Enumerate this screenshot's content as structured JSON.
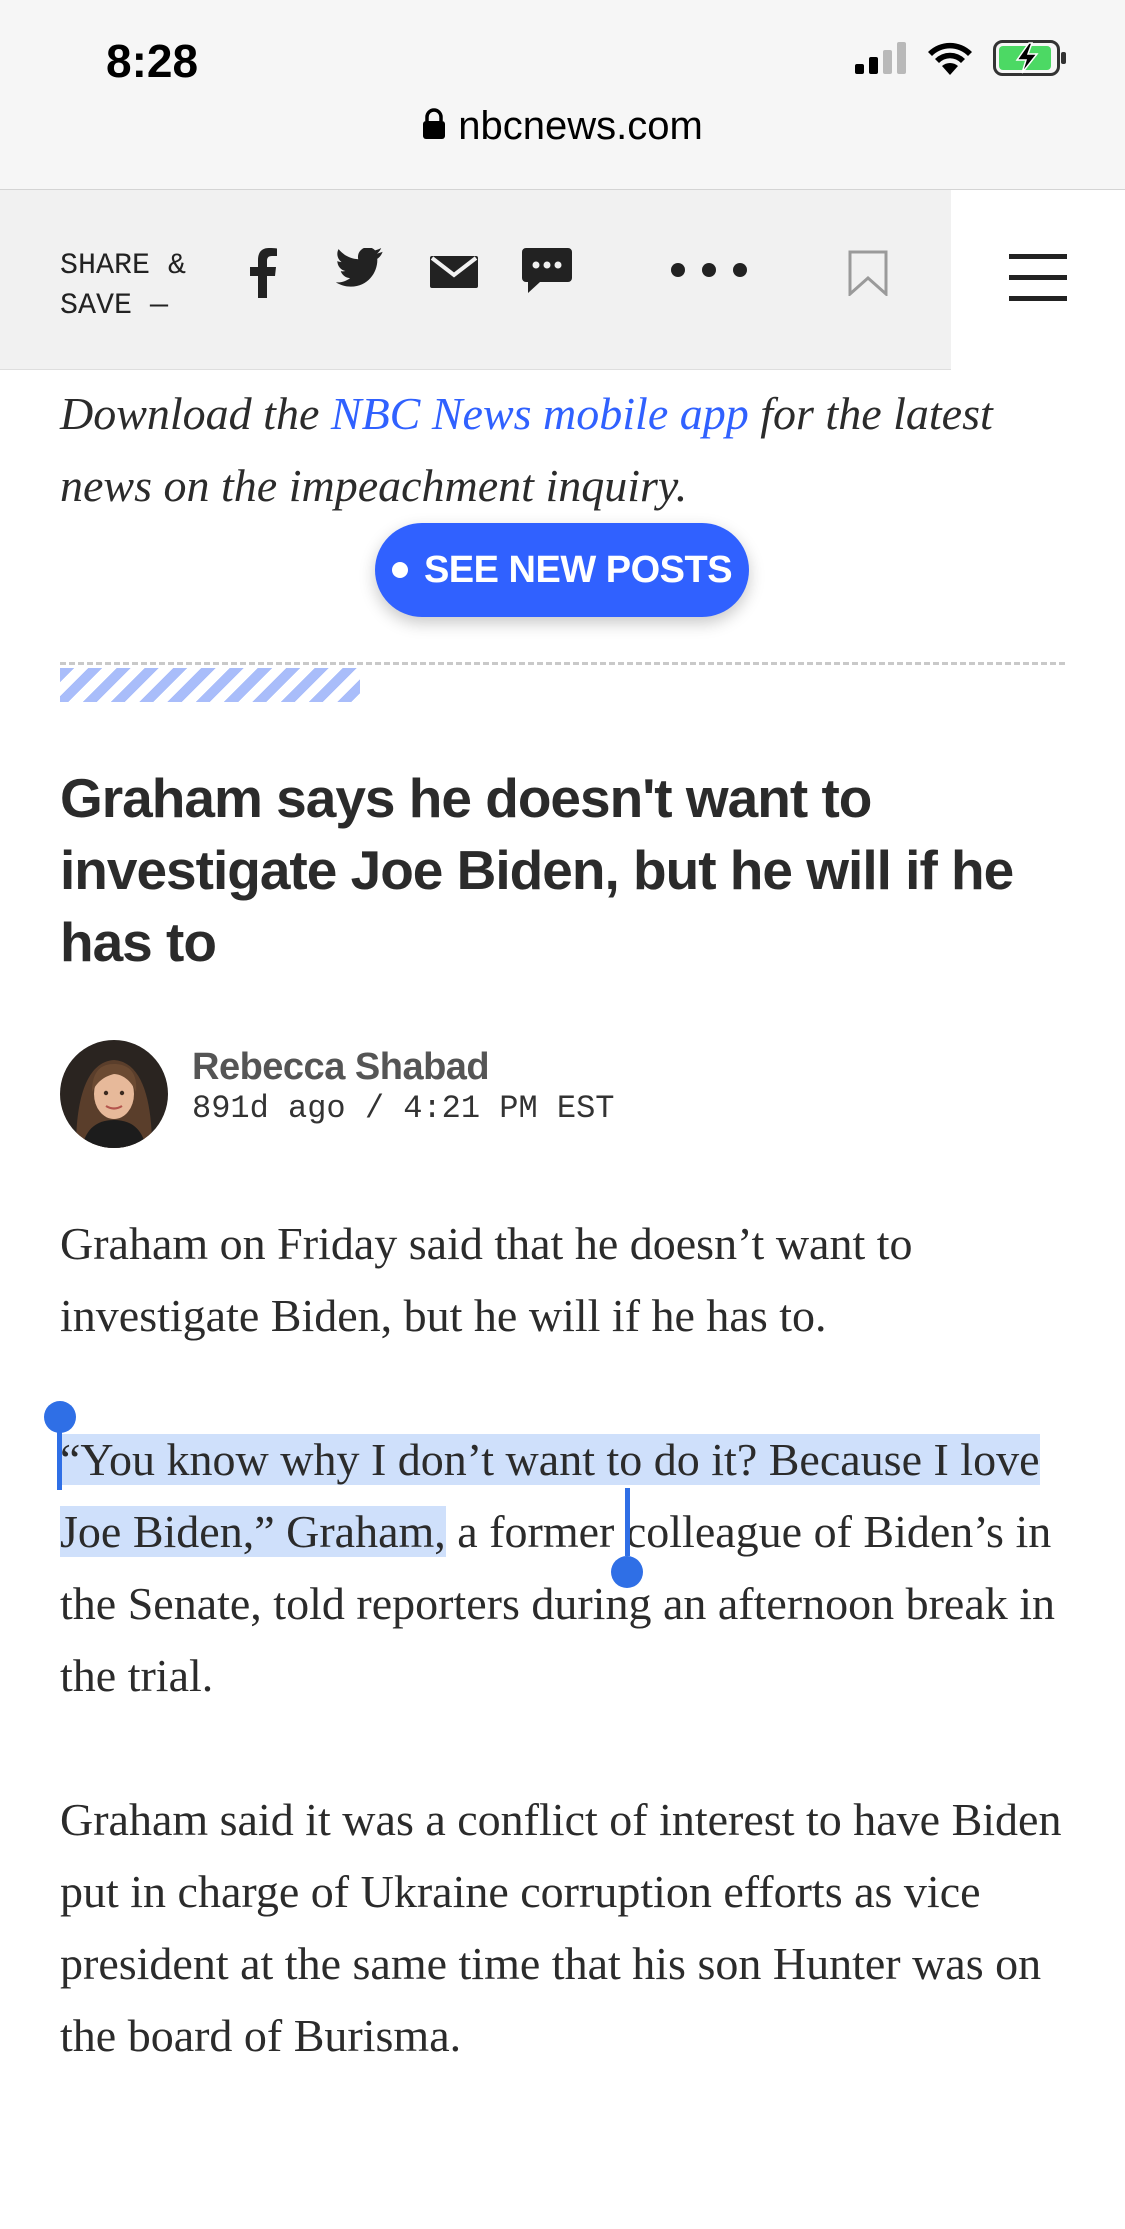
{
  "status_bar": {
    "time": "8:28",
    "url": "nbcnews.com",
    "icons": [
      "cellular-signal-icon",
      "wifi-icon",
      "battery-charging-icon",
      "lock-icon"
    ]
  },
  "share_bar": {
    "label": "SHARE &\nSAVE —",
    "icons": [
      "facebook-icon",
      "twitter-icon",
      "email-icon",
      "sms-icon",
      "more-icon",
      "bookmark-icon",
      "menu-icon"
    ]
  },
  "promo": {
    "prefix": "Download the ",
    "link": "NBC News mobile app",
    "suffix": " for the latest news on the impeachment inquiry."
  },
  "new_posts_button": "SEE NEW POSTS",
  "post": {
    "headline": "Graham says he doesn't want to investigate Joe Biden, but he will if he has to",
    "author": "Rebecca Shabad",
    "timestamp": "891d ago / 4:21 PM EST",
    "paragraphs": {
      "p1": "Graham on Friday said that he doesn’t want to investigate Biden, but he will if he has to.",
      "p2_selected": "“You know why I don’t want to do it? Because I love Joe Biden,” Graham,",
      "p2_rest": " a former colleague of Biden’s in the Senate, told reporters during an afternoon break in the trial.",
      "p3": "Graham said it was a conflict of interest to have Biden put in charge of Ukraine corruption efforts as vice president at the same time that his son Hunter was on the board of Burisma."
    }
  },
  "colors": {
    "accent": "#3061ff",
    "selection": "#cfe0fb",
    "selection_handle": "#2f6fe6",
    "text": "#2b2b2b"
  }
}
